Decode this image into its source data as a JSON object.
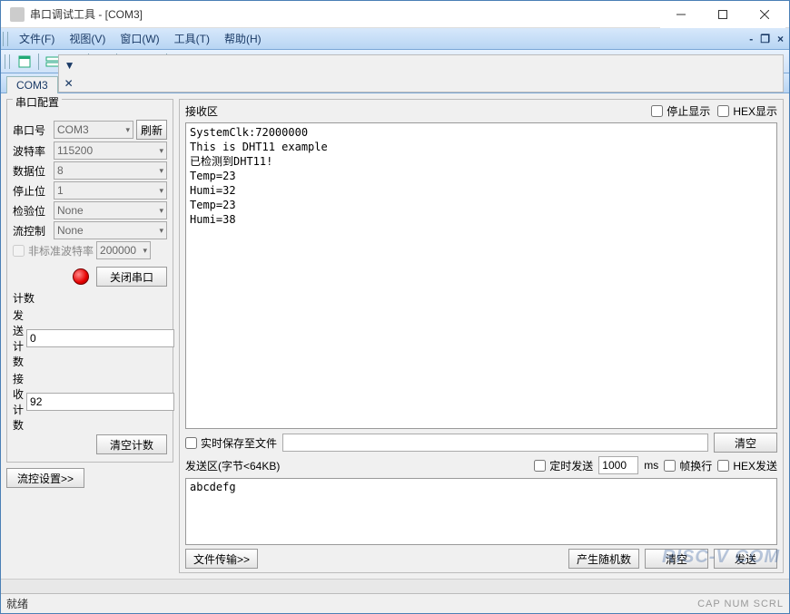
{
  "window": {
    "title": "串口调试工具 - [COM3]"
  },
  "menu": {
    "file": "文件(F)",
    "view": "视图(V)",
    "window": "窗口(W)",
    "tools": "工具(T)",
    "help": "帮助(H)"
  },
  "tab": {
    "label": "COM3",
    "pin": "▼",
    "close": "✕"
  },
  "config": {
    "title": "串口配置",
    "port_label": "串口号",
    "port_value": "COM3",
    "refresh": "刷新",
    "baud_label": "波特率",
    "baud_value": "115200",
    "data_label": "数据位",
    "data_value": "8",
    "stop_label": "停止位",
    "stop_value": "1",
    "parity_label": "检验位",
    "parity_value": "None",
    "flow_label": "流控制",
    "flow_value": "None",
    "nonstd_label": "非标准波特率",
    "nonstd_value": "200000",
    "close_port": "关闭串口",
    "count_title": "计数",
    "tx_count_label": "发送计数",
    "tx_count_value": "0",
    "rx_count_label": "接收计数",
    "rx_count_value": "92",
    "clear_count": "清空计数",
    "flow_settings": "流控设置>>"
  },
  "rx": {
    "title": "接收区",
    "stop_display": "停止显示",
    "hex_display": "HEX显示",
    "content": "SystemClk:72000000\nThis is DHT11 example\n已检测到DHT11!\nTemp=23\nHumi=32\nTemp=23\nHumi=38",
    "realtime_save": "实时保存至文件",
    "clear": "清空"
  },
  "tx": {
    "title": "发送区(字节<64KB)",
    "timed_send": "定时发送",
    "interval": "1000",
    "ms": "ms",
    "wrap": "帧换行",
    "hex_send": "HEX发送",
    "content": "abcdefg",
    "file_transfer": "文件传输>>",
    "gen_random": "产生随机数",
    "clear": "清空",
    "send": "发送"
  },
  "status": {
    "ready": "就绪",
    "indicators": "CAP  NUM  SCRL"
  },
  "watermark": "RISC-V COM"
}
